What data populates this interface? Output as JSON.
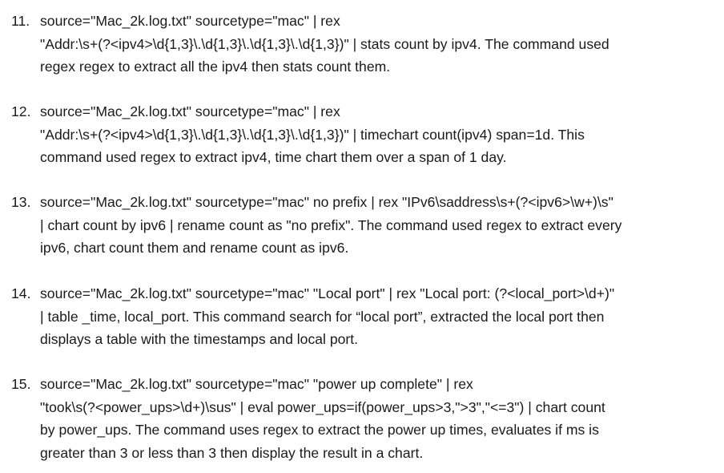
{
  "items": [
    {
      "number": "11.",
      "lines": [
        "source=\"Mac_2k.log.txt\" sourcetype=\"mac\" | rex",
        "\"Addr:\\s+(?<ipv4>\\d{1,3}\\.\\d{1,3}\\.\\d{1,3}\\.\\d{1,3})\" | stats count by ipv4. The command used",
        "regex regex to extract all the ipv4 then stats count them."
      ]
    },
    {
      "number": "12.",
      "lines": [
        "source=\"Mac_2k.log.txt\" sourcetype=\"mac\" | rex",
        "\"Addr:\\s+(?<ipv4>\\d{1,3}\\.\\d{1,3}\\.\\d{1,3}\\.\\d{1,3})\" | timechart count(ipv4) span=1d. This",
        "command used regex to extract ipv4, time chart them over a span of 1 day."
      ]
    },
    {
      "number": "13.",
      "lines": [
        "source=\"Mac_2k.log.txt\" sourcetype=\"mac\" no prefix | rex \"IPv6\\saddress\\s+(?<ipv6>\\w+)\\s\"",
        "| chart count by ipv6 | rename count as \"no prefix\". The command used regex to extract every",
        "ipv6, chart count them and rename count as ipv6."
      ]
    },
    {
      "number": "14.",
      "lines": [
        "source=\"Mac_2k.log.txt\" sourcetype=\"mac\" \"Local port\" | rex \"Local port: (?<local_port>\\d+)\"",
        "| table _time, local_port. This command search for “local port”, extracted the local port then",
        "displays a table with the timestamps and local port."
      ]
    },
    {
      "number": "15.",
      "lines": [
        "source=\"Mac_2k.log.txt\" sourcetype=\"mac\" \"power up complete\" | rex",
        "\"took\\s(?<power_ups>\\d+)\\sus\" | eval power_ups=if(power_ups>3,\">3\",\"<=3\") | chart count",
        "by power_ups. The command uses regex to extract the power up times, evaluates if ms is",
        "greater than 3 or less than 3 then display the result in a chart."
      ]
    }
  ]
}
